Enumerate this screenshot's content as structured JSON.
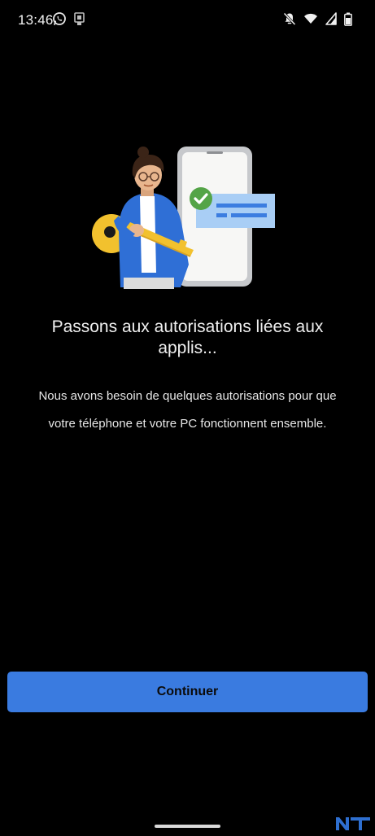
{
  "status_bar": {
    "time": "13:46",
    "icons_left": [
      "whatsapp-icon",
      "screen-cast-icon"
    ],
    "icons_right": [
      "notifications-off-icon",
      "wifi-icon",
      "signal-icon",
      "battery-icon"
    ]
  },
  "illustration": {
    "description_icon": "permissions-illustration",
    "colors": {
      "phone_body": "#c7c9cc",
      "phone_screen": "#f7f7f5",
      "key": "#f2c12e",
      "check": "#54a447",
      "card": "#a9cef5",
      "jacket": "#2f6fd6"
    }
  },
  "content": {
    "heading": "Passons aux autorisations liées aux applis...",
    "description": "Nous avons besoin de quelques autorisations pour que votre téléphone et votre PC fonctionnent ensemble."
  },
  "actions": {
    "continue_label": "Continuer",
    "accent_color": "#3a7be0"
  }
}
